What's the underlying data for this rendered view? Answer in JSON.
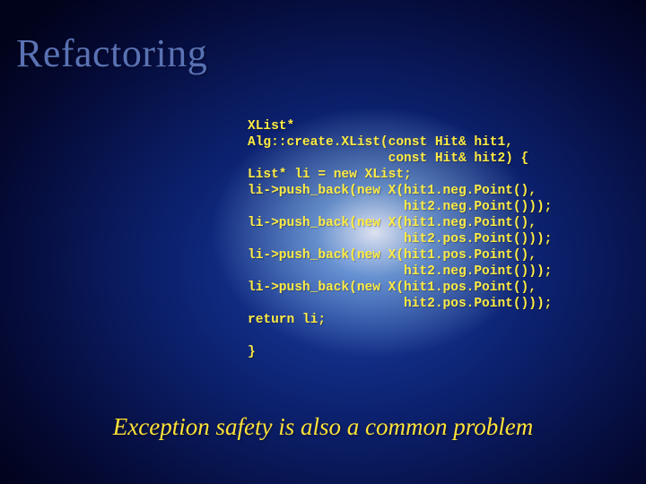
{
  "title": "Refactoring",
  "code_lines": [
    "XList*",
    "Alg::create.XList(const Hit& hit1,",
    "                  const Hit& hit2) {",
    "List* li = new XList;",
    "li->push_back(new X(hit1.neg.Point(),",
    "                    hit2.neg.Point()));",
    "li->push_back(new X(hit1.neg.Point(),",
    "                    hit2.pos.Point()));",
    "li->push_back(new X(hit1.pos.Point(),",
    "                    hit2.neg.Point()));",
    "li->push_back(new X(hit1.pos.Point(),",
    "                    hit2.pos.Point()));",
    "return li;",
    "",
    "}"
  ],
  "caption": "Exception safety is also a common problem"
}
